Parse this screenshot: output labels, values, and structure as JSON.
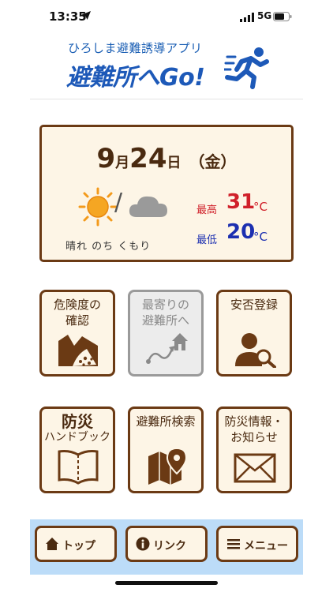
{
  "status_bar": {
    "time": "13:35",
    "network": "5G"
  },
  "header": {
    "subtitle": "ひろしま避難誘導アプリ",
    "title": "避難所へGo!"
  },
  "weather": {
    "month": "9",
    "month_unit": "月",
    "day": "24",
    "day_unit": "日",
    "weekday": "（金）",
    "description": "晴れ のち くもり",
    "high_label": "最高",
    "high_value": "31",
    "low_label": "最低",
    "low_value": "20",
    "unit": "°C",
    "icons": [
      "sun-icon",
      "cloud-icon"
    ]
  },
  "tiles": [
    {
      "line1": "危険度の",
      "line2": "確認",
      "icon": "landslide-icon",
      "enabled": true
    },
    {
      "line1": "最寄りの",
      "line2": "避難所へ",
      "icon": "route-home-icon",
      "enabled": false
    },
    {
      "line1": "安否登録",
      "line2": "",
      "icon": "person-search-icon",
      "enabled": true
    },
    {
      "line1": "防災",
      "line2": "ハンドブック",
      "icon": "book-icon",
      "enabled": true
    },
    {
      "line1": "避難所検索",
      "line2": "",
      "icon": "map-pin-icon",
      "enabled": true
    },
    {
      "line1": "防災情報・",
      "line2": "お知らせ",
      "icon": "mail-icon",
      "enabled": true
    }
  ],
  "footer": {
    "top_label": "トップ",
    "link_label": "リンク",
    "menu_label": "メニュー"
  },
  "colors": {
    "brown": "#6b3a14",
    "cream": "#fdf5e6",
    "blue": "#1d59b8",
    "hot": "#d0202a",
    "cold": "#1c2fb0",
    "footer_bg": "#bcdcf8"
  }
}
